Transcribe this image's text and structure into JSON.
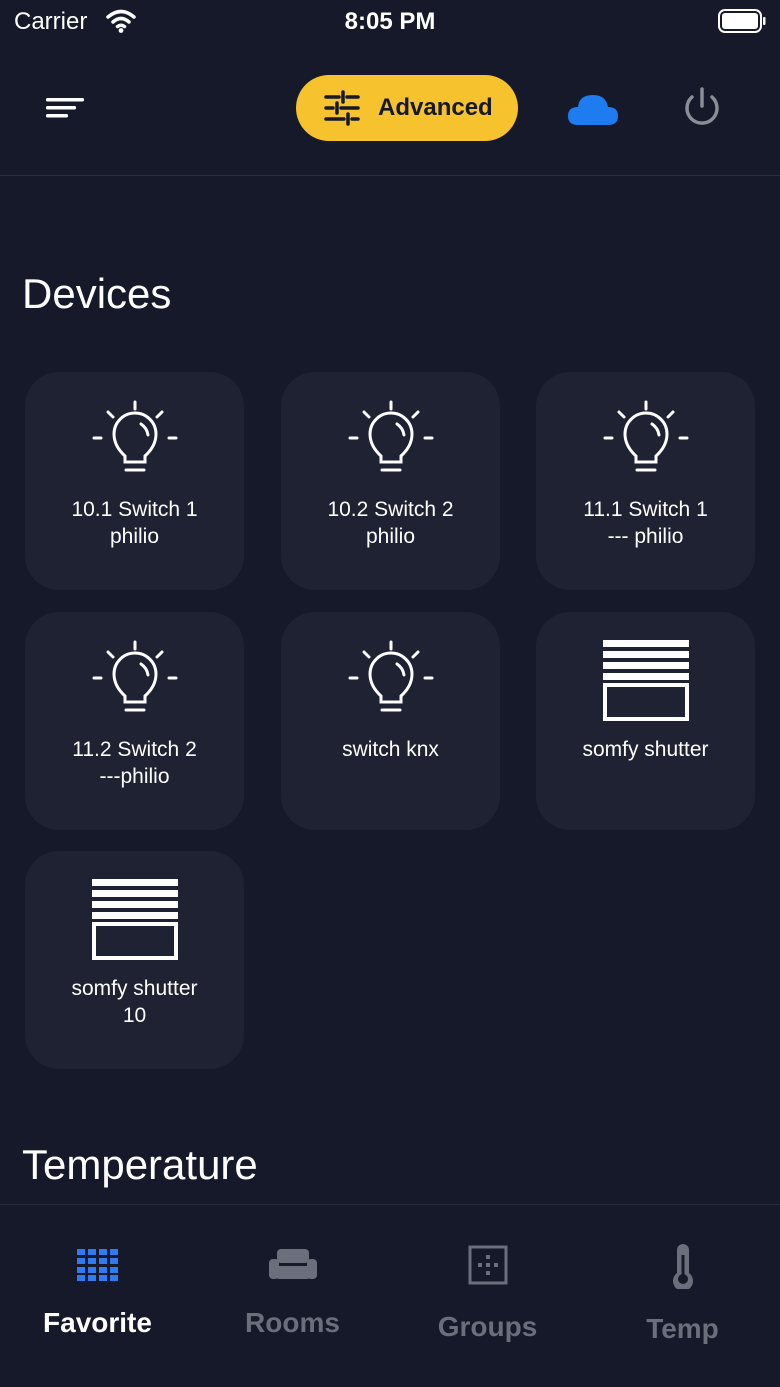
{
  "status_bar": {
    "carrier": "Carrier",
    "time": "8:05 PM"
  },
  "header": {
    "advanced_label": "Advanced"
  },
  "sections": {
    "devices_title": "Devices",
    "temperature_title": "Temperature"
  },
  "devices": [
    {
      "label": "10.1 Switch 1\nphilio",
      "icon": "lightbulb-icon"
    },
    {
      "label": "10.2 Switch 2\nphilio",
      "icon": "lightbulb-icon"
    },
    {
      "label": "11.1 Switch 1\n--- philio",
      "icon": "lightbulb-icon"
    },
    {
      "label": "11.2 Switch 2\n---philio",
      "icon": "lightbulb-icon"
    },
    {
      "label": "switch knx",
      "icon": "lightbulb-icon"
    },
    {
      "label": "somfy shutter",
      "icon": "shutter-icon"
    },
    {
      "label": "somfy shutter\n10",
      "icon": "shutter-icon"
    }
  ],
  "tabs": [
    {
      "label": "Favorite",
      "icon": "grid-icon",
      "active": true
    },
    {
      "label": "Rooms",
      "icon": "sofa-icon",
      "active": false
    },
    {
      "label": "Groups",
      "icon": "groups-icon",
      "active": false
    },
    {
      "label": "Temp",
      "icon": "thermometer-icon",
      "active": false
    }
  ],
  "colors": {
    "background": "#151929",
    "tile": "#1e2233",
    "accent": "#f6c22e",
    "cloud": "#1e7cf0",
    "tab_active_icon": "#2e7bf2",
    "tab_inactive": "#6b6f7c"
  }
}
